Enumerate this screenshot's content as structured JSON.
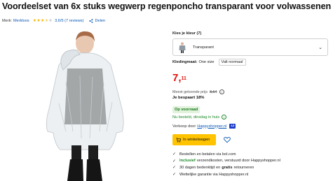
{
  "title": "Voordeelset van 6x stuks wegwerp regenponcho transparant voor volwassenen",
  "meta": {
    "brand_prefix": "Merk:",
    "brand": "Merkloos",
    "rating_score": 3.6,
    "rating_text": "3,6/5 (7 reviews)",
    "share_label": "Delen"
  },
  "variant": {
    "color_label": "Kies je kleur (7)",
    "color_value": "Transparant",
    "size_label": "Kledingmaat:",
    "size_selected": "One size",
    "size_option": "Valt normaal"
  },
  "pricing": {
    "price_main": "7,",
    "price_cents": "11",
    "compare_label": "Meest getoonde prijs",
    "compare_price": "8,64",
    "saving": "Je bespaart 18%"
  },
  "stock": {
    "badge": "Op voorraad",
    "delivery": "Nu besteld, dinsdag in huis",
    "seller_prefix": "Verkoop door",
    "seller": "Happyshopper.nl",
    "seller_badge": "4,8"
  },
  "actions": {
    "cart_label": "In winkelwagen"
  },
  "usps": [
    {
      "prefix": "",
      "text": "Bestellen en betalen via bol.com"
    },
    {
      "prefix": "Inclusief",
      "text": "verzendkosten, verstuurd door Happyshopper.nl"
    },
    {
      "prefix": "",
      "text": "30 dagen bedenktijd en",
      "bold": "gratis",
      "suffix": "retourneren"
    },
    {
      "prefix": "",
      "text": "Wettelijke garantie via Happyshopper.nl"
    }
  ],
  "colors": {
    "accent_yellow": "#ffc300",
    "price_red": "#e3120b",
    "link_blue": "#0a58b5",
    "stock_green": "#1d8a2a"
  }
}
